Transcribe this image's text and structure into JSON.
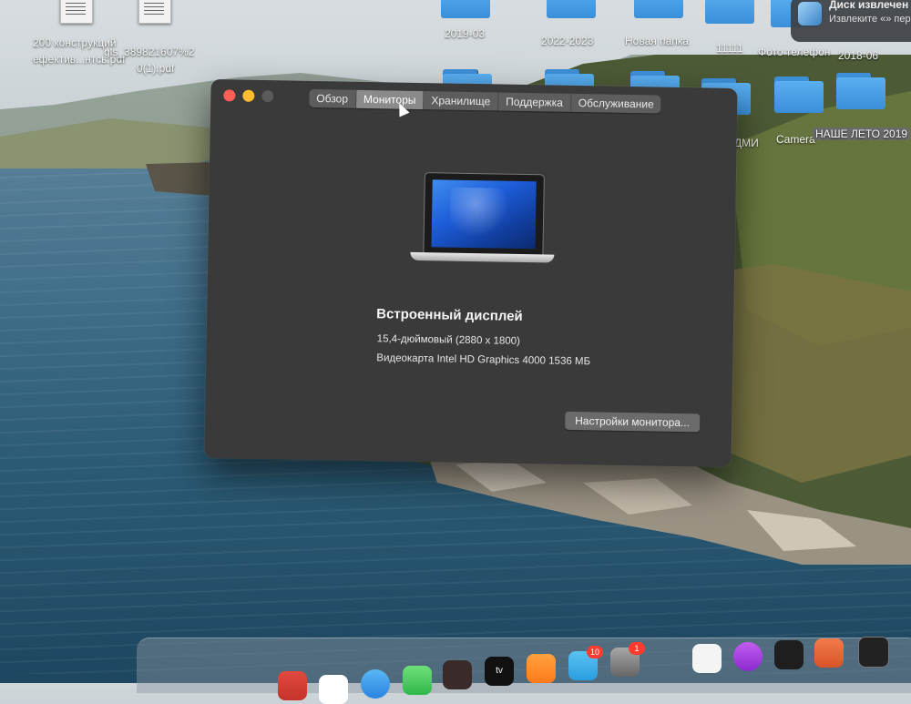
{
  "desktop": {
    "items": [
      {
        "label": "2019-03"
      },
      {
        "label": "2022-2023"
      },
      {
        "label": "Новая папка"
      },
      {
        "label": "11111"
      },
      {
        "label": "Фото телефон"
      },
      {
        "label": "2018-06"
      },
      {
        "label": "ДМИ"
      },
      {
        "label": "Camera"
      },
      {
        "label": "НАШЕ ЛЕТО 2019"
      },
      {
        "label": "200 конструкций"
      },
      {
        "label": "ефектив...нтсь.pdf"
      },
      {
        "label": "gls_389821607%2"
      },
      {
        "label": "0(1).pdf"
      }
    ]
  },
  "notification": {
    "title": "Диск извлечен не",
    "body": "Извлеките «» перед"
  },
  "window": {
    "tabs": [
      {
        "label": "Обзор",
        "active": false
      },
      {
        "label": "Мониторы",
        "active": true
      },
      {
        "label": "Хранилище",
        "active": false
      },
      {
        "label": "Поддержка",
        "active": false
      },
      {
        "label": "Обслуживание",
        "active": false
      }
    ],
    "display_name": "Встроенный дисплей",
    "size_line": "15,4-дюймовый (2880 x 1800)",
    "graphics_line": "Видеокарта Intel HD Graphics 4000 1536 МБ",
    "settings_button": "Настройки монитора..."
  },
  "dock": {
    "apps": [
      {
        "name": "photos",
        "badge": ""
      },
      {
        "name": "finder-generic",
        "badge": ""
      },
      {
        "name": "facetime",
        "badge": ""
      },
      {
        "name": "photo-booth",
        "badge": ""
      },
      {
        "name": "apple-tv",
        "label": "tv",
        "badge": ""
      },
      {
        "name": "books",
        "badge": ""
      },
      {
        "name": "telegram",
        "badge": "10"
      },
      {
        "name": "system-preferences",
        "badge": "1"
      },
      {
        "name": "textedit",
        "badge": ""
      },
      {
        "name": "podcasts",
        "badge": ""
      },
      {
        "name": "figma",
        "badge": ""
      },
      {
        "name": "migration",
        "badge": ""
      },
      {
        "name": "terminal",
        "badge": ""
      }
    ]
  },
  "colors": {
    "window_bg": "#3a3a3a",
    "active_tab": "#8a8a8a",
    "folder": "#3b8ed9",
    "close": "#ff5f57",
    "minimize": "#febc2e"
  }
}
